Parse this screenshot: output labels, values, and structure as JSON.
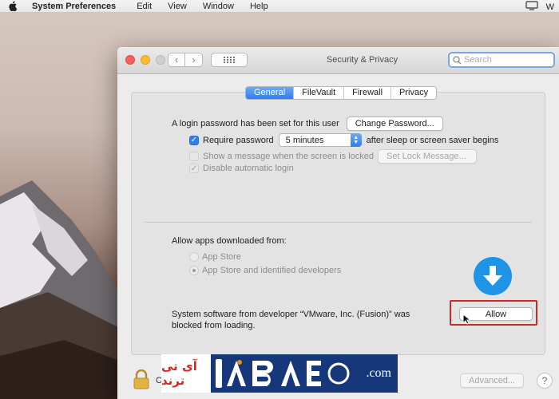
{
  "menubar": {
    "app_name": "System Preferences",
    "items": [
      "Edit",
      "View",
      "Window",
      "Help"
    ]
  },
  "window": {
    "title": "Security & Privacy",
    "search_placeholder": "Search",
    "tabs": [
      {
        "label": "General",
        "active": true
      },
      {
        "label": "FileVault",
        "active": false
      },
      {
        "label": "Firewall",
        "active": false
      },
      {
        "label": "Privacy",
        "active": false
      }
    ]
  },
  "general": {
    "login_password_text": "A login password has been set for this user",
    "change_password_label": "Change Password...",
    "require_password": {
      "label": "Require password",
      "checked": true
    },
    "require_password_delay": "5 minutes",
    "require_password_suffix": "after sleep or screen saver begins",
    "show_message": {
      "label": "Show a message when the screen is locked",
      "checked": false
    },
    "set_lock_message_label": "Set Lock Message...",
    "disable_auto_login": {
      "label": "Disable automatic login",
      "checked": true
    },
    "allow_apps_heading": "Allow apps downloaded from:",
    "radio_app_store": "App Store",
    "radio_app_store_identified": "App Store and identified developers",
    "blocked_message_line1": "System software from developer “VMware, Inc. (Fusion)” was",
    "blocked_message_line2": "blocked from loading.",
    "allow_label": "Allow"
  },
  "footer": {
    "lock_text_partial": "C",
    "advanced_label": "Advanced...",
    "help_label": "?"
  },
  "watermark": {
    "left_text": "آی تی ترند",
    "right_text": ".com"
  },
  "colors": {
    "accent": "#2f7ff0",
    "highlight_box": "#cc2a2a",
    "download_icon": "#1d94e6",
    "watermark_bg": "#16387a"
  }
}
